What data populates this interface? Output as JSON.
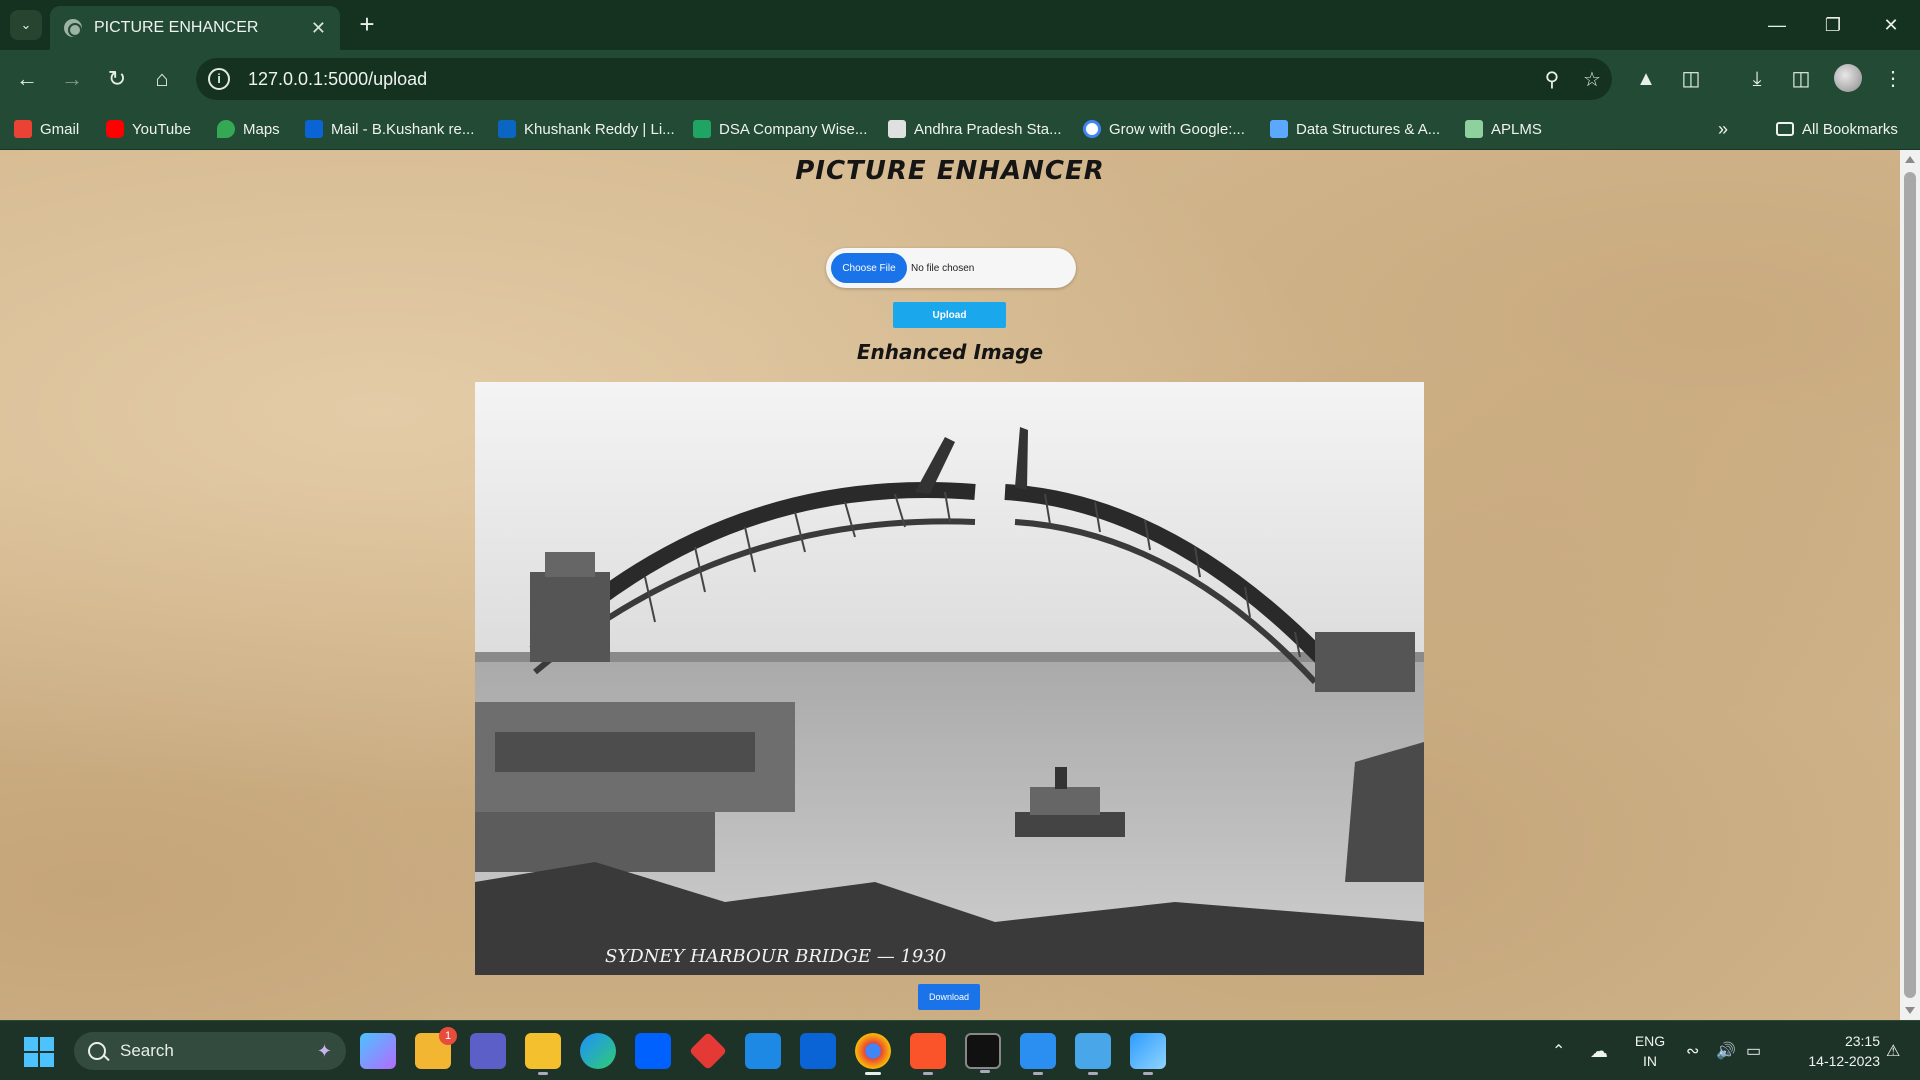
{
  "browser": {
    "tab_title": "PICTURE ENHANCER",
    "url": "127.0.0.1:5000/upload",
    "bookmarks": [
      {
        "label": "Gmail",
        "icon": "gmail-icon",
        "color": "#ea4335"
      },
      {
        "label": "YouTube",
        "icon": "youtube-icon",
        "color": "#ff0000"
      },
      {
        "label": "Maps",
        "icon": "maps-icon",
        "color": "#34a853"
      },
      {
        "label": "Mail - B.Kushank re...",
        "icon": "outlook-icon",
        "color": "#0a64d6"
      },
      {
        "label": "Khushank Reddy | Li...",
        "icon": "linkedin-icon",
        "color": "#0a66c2"
      },
      {
        "label": "DSA Company Wise...",
        "icon": "sheets-icon",
        "color": "#1fa463"
      },
      {
        "label": "Andhra Pradesh Sta...",
        "icon": "image-icon",
        "color": "#e0e0e0"
      },
      {
        "label": "Grow with Google:...",
        "icon": "google-icon",
        "color": "#4285f4"
      },
      {
        "label": "Data Structures & A...",
        "icon": "udemy-icon",
        "color": "#5aa9ff"
      },
      {
        "label": "APLMS",
        "icon": "aplms-icon",
        "color": "#8fd19e"
      }
    ],
    "all_bookmarks_label": "All Bookmarks"
  },
  "page": {
    "title": "PICTURE ENHANCER",
    "choose_file_label": "Choose File",
    "file_status": "No file chosen",
    "upload_label": "Upload",
    "enhanced_heading": "Enhanced Image",
    "download_label": "Download",
    "image_watermark": "SYDNEY HARBOUR BRIDGE — 1930"
  },
  "taskbar": {
    "search_label": "Search",
    "lang_line1": "ENG",
    "lang_line2": "IN",
    "time": "23:15",
    "date": "14-12-2023",
    "notification_badge": "1"
  }
}
